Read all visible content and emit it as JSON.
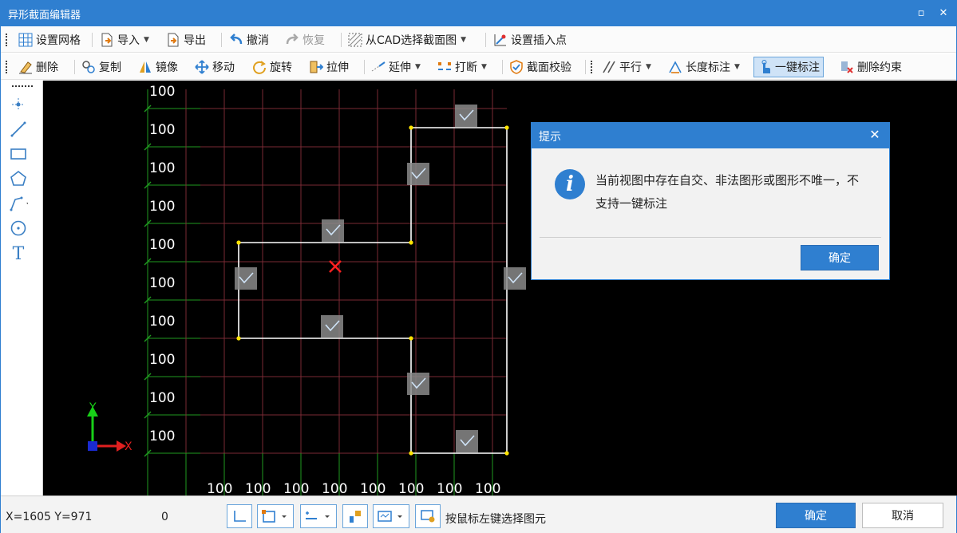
{
  "window": {
    "title": "异形截面编辑器",
    "restore_glyph": "▫",
    "close_glyph": "✕"
  },
  "toolbar1": {
    "set_grid": "设置网格",
    "import": "导入",
    "export": "导出",
    "undo": "撤消",
    "redo": "恢复",
    "from_cad": "从CAD选择截面图",
    "set_insert_point": "设置插入点"
  },
  "toolbar2": {
    "delete": "删除",
    "copy": "复制",
    "mirror": "镜像",
    "move": "移动",
    "rotate": "旋转",
    "stretch": "拉伸",
    "extend": "延伸",
    "break": "打断",
    "check": "截面校验",
    "parallel": "平行",
    "length_dim": "长度标注",
    "auto_dim": "一键标注",
    "delete_constraint": "删除约束"
  },
  "left_tools": [
    "point-tool",
    "line-tool",
    "rectangle-tool",
    "polygon-tool",
    "polyline-tool",
    "circle-tool",
    "text-tool"
  ],
  "canvas": {
    "row_labels": [
      "100",
      "100",
      "100",
      "100",
      "100",
      "100",
      "100",
      "100",
      "100",
      "100"
    ],
    "col_labels": [
      "100",
      "100",
      "100",
      "100",
      "100",
      "100",
      "100",
      "100"
    ],
    "axis_x": "X",
    "axis_y": "Y"
  },
  "statusbar": {
    "coords": "X=1605 Y=971",
    "value": "0",
    "hint": "按鼠标左键选择图元",
    "ok": "确定",
    "cancel": "取消"
  },
  "dialog": {
    "title": "提示",
    "message": "当前视图中存在自交、非法图形或图形不唯一，不支持一键标注",
    "ok": "确定",
    "close_glyph": "✕",
    "icon": "info-icon"
  },
  "colors": {
    "accent": "#2f7fd0",
    "grid_green": "#1f9a1f",
    "grid_red": "#7a2a35",
    "shape_white": "#ffffff",
    "vertex_yellow": "#ffe400",
    "marker_red": "#ff2020"
  }
}
